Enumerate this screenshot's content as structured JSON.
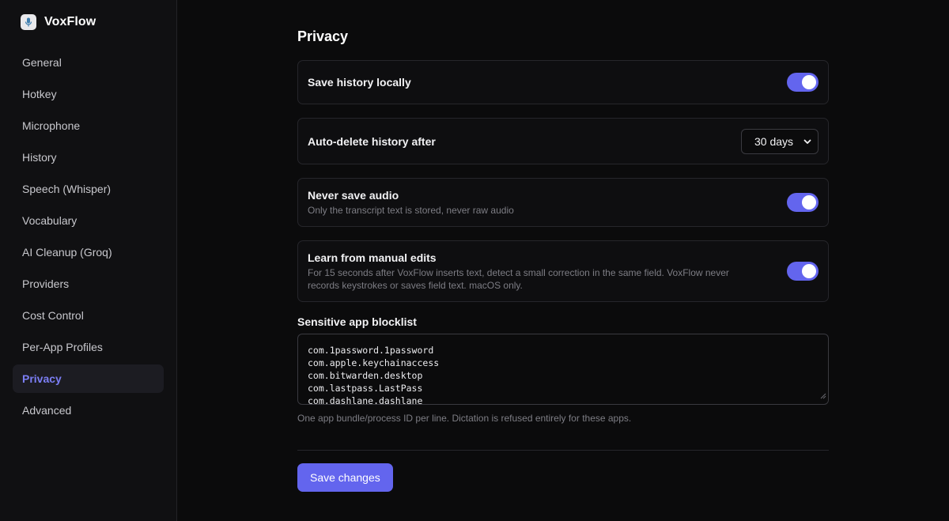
{
  "brand": {
    "name": "VoxFlow",
    "logo_icon": "microphone-icon"
  },
  "sidebar": {
    "items": [
      {
        "label": "General",
        "active": false
      },
      {
        "label": "Hotkey",
        "active": false
      },
      {
        "label": "Microphone",
        "active": false
      },
      {
        "label": "History",
        "active": false
      },
      {
        "label": "Speech (Whisper)",
        "active": false
      },
      {
        "label": "Vocabulary",
        "active": false
      },
      {
        "label": "AI Cleanup (Groq)",
        "active": false
      },
      {
        "label": "Providers",
        "active": false
      },
      {
        "label": "Cost Control",
        "active": false
      },
      {
        "label": "Per-App Profiles",
        "active": false
      },
      {
        "label": "Privacy",
        "active": true
      },
      {
        "label": "Advanced",
        "active": false
      }
    ]
  },
  "page": {
    "title": "Privacy",
    "save_history": {
      "label": "Save history locally",
      "enabled": true
    },
    "auto_delete": {
      "label": "Auto-delete history after",
      "selected": "30 days"
    },
    "never_save_audio": {
      "label": "Never save audio",
      "description": "Only the transcript text is stored, never raw audio",
      "enabled": true
    },
    "learn_edits": {
      "label": "Learn from manual edits",
      "description_line1": "For 15 seconds after VoxFlow inserts text, detect a small correction in the same field. VoxFlow never",
      "description_line2": "records keystrokes or saves field text. macOS only.",
      "enabled": true
    },
    "blocklist": {
      "label": "Sensitive app blocklist",
      "entries": [
        "com.1password.1password",
        "com.apple.keychainaccess",
        "com.bitwarden.desktop",
        "com.lastpass.LastPass",
        "com.dashlane.dashlane"
      ],
      "hint": "One app bundle/process ID per line. Dictation is refused entirely for these apps."
    },
    "save_button": "Save changes"
  },
  "colors": {
    "accent": "#6365ee",
    "active_nav_text": "#7b7ef4",
    "background": "#0b0b0c",
    "sidebar_background": "#101012"
  }
}
